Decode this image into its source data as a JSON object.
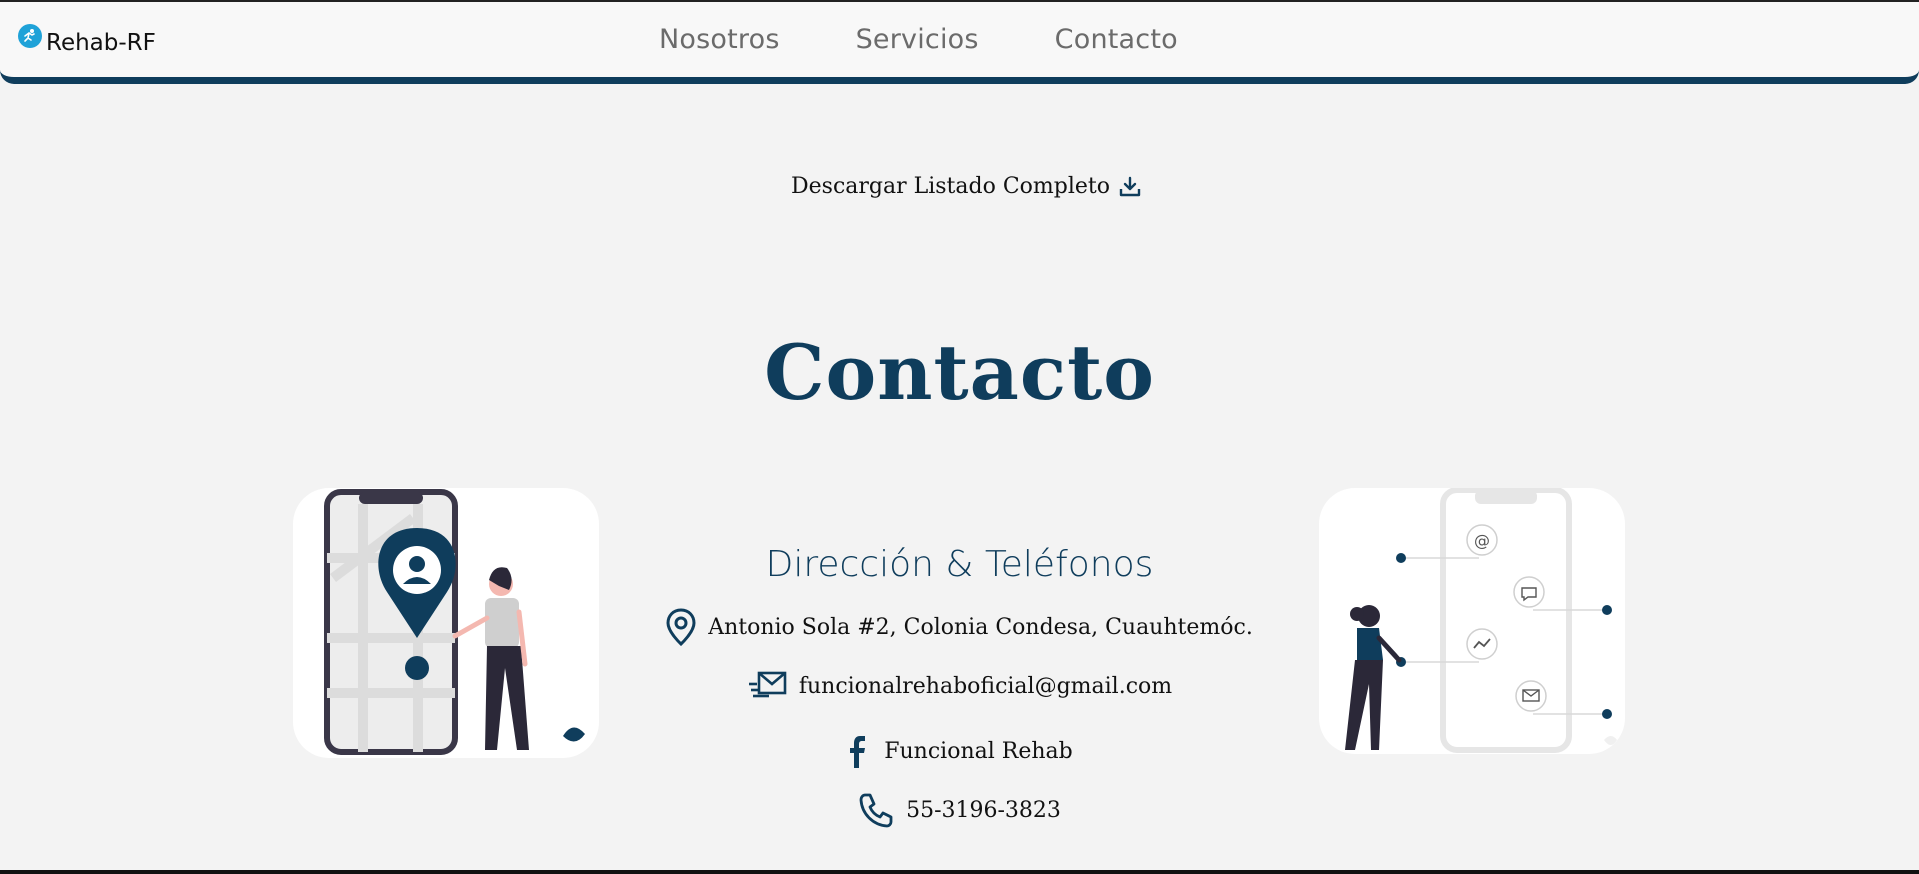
{
  "brand": {
    "name": "Rehab-RF",
    "logo_icon": "runner-logo-icon"
  },
  "nav": {
    "links": [
      "Nosotros",
      "Servicios",
      "Contacto"
    ]
  },
  "download": {
    "label": "Descargar Listado Completo",
    "icon": "download-icon"
  },
  "contact": {
    "title": "Contacto",
    "subtitle": "Dirección & Teléfonos",
    "address": "Antonio Sola #2, Colonia Condesa, Cuauhtemóc.",
    "email": "funcionalrehaboficial@gmail.com",
    "facebook": "Funcional Rehab",
    "phone": "55-3196-3823"
  },
  "colors": {
    "primary": "#0f3d5c",
    "background": "#f3f3f3",
    "logo": "#1fa2d8"
  }
}
